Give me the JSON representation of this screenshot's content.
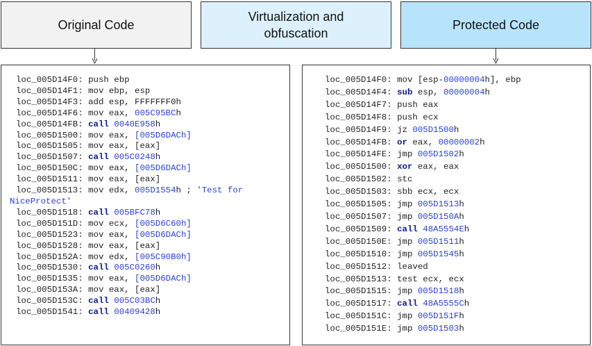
{
  "headers": {
    "original": {
      "label": "Original Code",
      "fill": "#f2f2f2"
    },
    "middle": {
      "line1": "Virtualization and",
      "line2": "obfuscation",
      "fill": "#ddf1fc"
    },
    "protected": {
      "label": "Protected Code",
      "fill": "#b8e4fb"
    }
  },
  "original_lines": [
    [
      [
        "loc_005D14F0: push ebp",
        "t"
      ]
    ],
    [
      [
        "loc_005D14F1: mov ebp, esp",
        "t"
      ]
    ],
    [
      [
        "loc_005D14F3: add esp, FFFFFFF0h",
        "t"
      ]
    ],
    [
      [
        "loc_005D14F6: mov eax, ",
        "t"
      ],
      [
        "005C95BC",
        "n"
      ],
      [
        "h",
        "t"
      ]
    ],
    [
      [
        "loc_005D14FB: ",
        "t"
      ],
      [
        "call",
        "k"
      ],
      [
        " ",
        "t"
      ],
      [
        "0040E958",
        "n"
      ],
      [
        "h",
        "t"
      ]
    ],
    [
      [
        "loc_005D1500: mov eax, ",
        "t"
      ],
      [
        "[005D6DACh]",
        "n"
      ]
    ],
    [
      [
        "loc_005D1505: mov eax, [eax]",
        "t"
      ]
    ],
    [
      [
        "loc_005D1507: ",
        "t"
      ],
      [
        "call",
        "k"
      ],
      [
        " ",
        "t"
      ],
      [
        "005C0248",
        "n"
      ],
      [
        "h",
        "t"
      ]
    ],
    [
      [
        "loc_005D150C: mov eax, ",
        "t"
      ],
      [
        "[005D6DACh]",
        "n"
      ]
    ],
    [
      [
        "loc_005D1511: mov eax, [eax]",
        "t"
      ]
    ],
    [
      [
        "loc_005D1513: mov edx, ",
        "t"
      ],
      [
        "005D1554",
        "n"
      ],
      [
        "h ; ",
        "t"
      ],
      [
        "'Test for",
        "s"
      ]
    ],
    [
      [
        "NiceProtect'",
        "s"
      ]
    ],
    [
      [
        "loc_005D1518: ",
        "t"
      ],
      [
        "call",
        "k"
      ],
      [
        " ",
        "t"
      ],
      [
        "005BFC78",
        "n"
      ],
      [
        "h",
        "t"
      ]
    ],
    [
      [
        "loc_005D151D: mov ecx, ",
        "t"
      ],
      [
        "[005D6C60h]",
        "n"
      ]
    ],
    [
      [
        "loc_005D1523: mov eax, ",
        "t"
      ],
      [
        "[005D6DACh]",
        "n"
      ]
    ],
    [
      [
        "loc_005D1528: mov eax, [eax]",
        "t"
      ]
    ],
    [
      [
        "loc_005D152A: mov edx, ",
        "t"
      ],
      [
        "[005C90B0h]",
        "n"
      ]
    ],
    [
      [
        "loc_005D1530: ",
        "t"
      ],
      [
        "call",
        "k"
      ],
      [
        " ",
        "t"
      ],
      [
        "005C0260",
        "n"
      ],
      [
        "h",
        "t"
      ]
    ],
    [
      [
        "loc_005D1535: mov eax, ",
        "t"
      ],
      [
        "[005D6DACh]",
        "n"
      ]
    ],
    [
      [
        "loc_005D153A: mov eax, [eax]",
        "t"
      ]
    ],
    [
      [
        "loc_005D153C: ",
        "t"
      ],
      [
        "call",
        "k"
      ],
      [
        " ",
        "t"
      ],
      [
        "005C03BC",
        "n"
      ],
      [
        "h",
        "t"
      ]
    ],
    [
      [
        "loc_005D1541: ",
        "t"
      ],
      [
        "call",
        "k"
      ],
      [
        " ",
        "t"
      ],
      [
        "00409428",
        "n"
      ],
      [
        "h",
        "t"
      ]
    ]
  ],
  "original_unindented": [
    11
  ],
  "protected_lines": [
    [
      [
        "loc_005D14F0: mov [esp-",
        "t"
      ],
      [
        "00000004",
        "n"
      ],
      [
        "h], ebp",
        "t"
      ]
    ],
    [
      [
        "loc_005D14F4: ",
        "t"
      ],
      [
        "sub",
        "k"
      ],
      [
        " esp, ",
        "t"
      ],
      [
        "00000004",
        "n"
      ],
      [
        "h",
        "t"
      ]
    ],
    [
      [
        "loc_005D14F7: push eax",
        "t"
      ]
    ],
    [
      [
        "loc_005D14F8: push ecx",
        "t"
      ]
    ],
    [
      [
        "loc_005D14F9: jz ",
        "t"
      ],
      [
        "005D1500",
        "n"
      ],
      [
        "h",
        "t"
      ]
    ],
    [
      [
        "loc_005D14FB: ",
        "t"
      ],
      [
        "or",
        "k"
      ],
      [
        " eax, ",
        "t"
      ],
      [
        "00000002",
        "n"
      ],
      [
        "h",
        "t"
      ]
    ],
    [
      [
        "loc_005D14FE: jmp ",
        "t"
      ],
      [
        "005D1502",
        "n"
      ],
      [
        "h",
        "t"
      ]
    ],
    [
      [
        "loc_005D1500: ",
        "t"
      ],
      [
        "xor",
        "k"
      ],
      [
        " eax, eax",
        "t"
      ]
    ],
    [
      [
        "loc_005D1502: stc",
        "t"
      ]
    ],
    [
      [
        "loc_005D1503: sbb ecx, ecx",
        "t"
      ]
    ],
    [
      [
        "loc_005D1505: jmp ",
        "t"
      ],
      [
        "005D1513",
        "n"
      ],
      [
        "h",
        "t"
      ]
    ],
    [
      [
        "loc_005D1507: jmp ",
        "t"
      ],
      [
        "005D150A",
        "n"
      ],
      [
        "h",
        "t"
      ]
    ],
    [
      [
        "loc_005D1509: ",
        "t"
      ],
      [
        "call",
        "k"
      ],
      [
        " ",
        "t"
      ],
      [
        "48A5554E",
        "n"
      ],
      [
        "h",
        "t"
      ]
    ],
    [
      [
        "loc_005D150E: jmp ",
        "t"
      ],
      [
        "005D1511",
        "n"
      ],
      [
        "h",
        "t"
      ]
    ],
    [
      [
        "loc_005D1510: jmp ",
        "t"
      ],
      [
        "005D1545",
        "n"
      ],
      [
        "h",
        "t"
      ]
    ],
    [
      [
        "loc_005D1512: leaved",
        "t"
      ]
    ],
    [
      [
        "loc_005D1513: test ecx, ecx",
        "t"
      ]
    ],
    [
      [
        "loc_005D1515: jmp ",
        "t"
      ],
      [
        "005D1518",
        "n"
      ],
      [
        "h",
        "t"
      ]
    ],
    [
      [
        "loc_005D1517: ",
        "t"
      ],
      [
        "call",
        "k"
      ],
      [
        " ",
        "t"
      ],
      [
        "48A5555C",
        "n"
      ],
      [
        "h",
        "t"
      ]
    ],
    [
      [
        "loc_005D151C: jmp ",
        "t"
      ],
      [
        "005D151F",
        "n"
      ],
      [
        "h",
        "t"
      ]
    ],
    [
      [
        "loc_005D151E: jmp ",
        "t"
      ],
      [
        "005D1503",
        "n"
      ],
      [
        "h",
        "t"
      ]
    ]
  ]
}
